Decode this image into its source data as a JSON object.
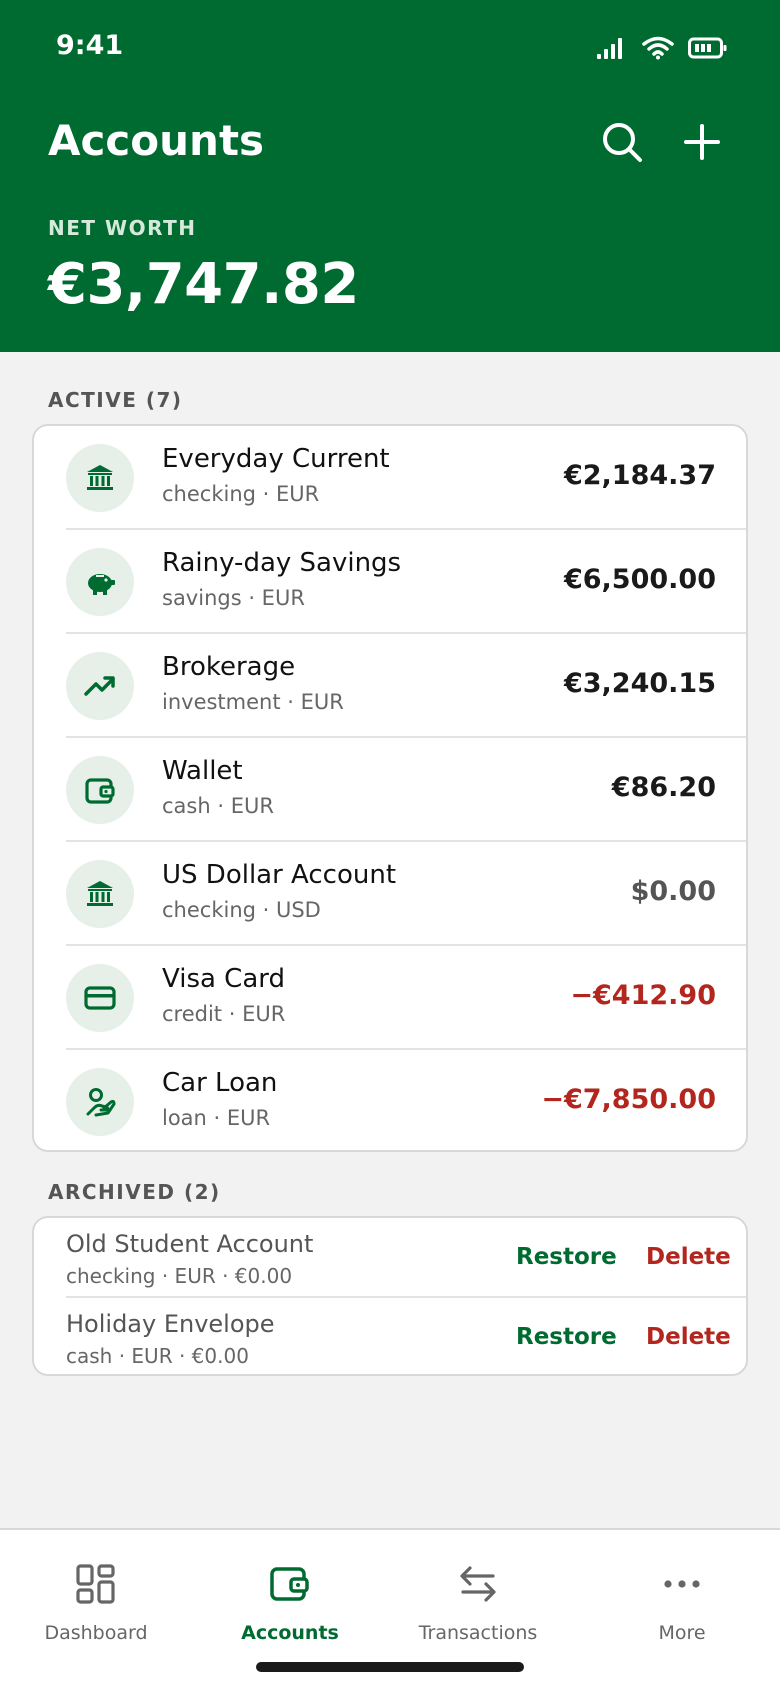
{
  "status_bar": {
    "time": "9:41"
  },
  "header": {
    "title": "Accounts",
    "net_worth_label": "NET WORTH",
    "net_worth_value": "€3,747.82"
  },
  "active": {
    "label": "ACTIVE (7)",
    "accounts": [
      {
        "name": "Everyday Current",
        "meta": "checking · EUR",
        "balance": "€2,184.37",
        "icon": "bank-icon"
      },
      {
        "name": "Rainy-day Savings",
        "meta": "savings · EUR",
        "balance": "€6,500.00",
        "icon": "piggy-bank-icon"
      },
      {
        "name": "Brokerage",
        "meta": "investment · EUR",
        "balance": "€3,240.15",
        "icon": "trending-up-icon"
      },
      {
        "name": "Wallet",
        "meta": "cash · EUR",
        "balance": "€86.20",
        "icon": "wallet-icon"
      },
      {
        "name": "US Dollar Account",
        "meta": "checking · USD",
        "balance": "$0.00",
        "icon": "bank-icon"
      },
      {
        "name": "Visa Card",
        "meta": "credit · EUR",
        "balance": "−€412.90",
        "icon": "credit-card-icon"
      },
      {
        "name": "Car Loan",
        "meta": "loan · EUR",
        "balance": "−€7,850.00",
        "icon": "hand-coin-icon"
      }
    ]
  },
  "archived": {
    "label": "ARCHIVED (2)",
    "restore_label": "Restore",
    "delete_label": "Delete",
    "accounts": [
      {
        "name": "Old Student Account",
        "meta": "checking · EUR · €0.00"
      },
      {
        "name": "Holiday Envelope",
        "meta": "cash · EUR · €0.00"
      }
    ]
  },
  "tabs": [
    {
      "label": "Dashboard",
      "icon": "dashboard-icon"
    },
    {
      "label": "Accounts",
      "icon": "wallet-icon"
    },
    {
      "label": "Transactions",
      "icon": "transfer-arrows-icon"
    },
    {
      "label": "More",
      "icon": "more-dots-icon"
    }
  ],
  "colors": {
    "brand_green": "#006b30",
    "negative_red": "#b3261e",
    "icon_bg": "#e6f0e9"
  }
}
